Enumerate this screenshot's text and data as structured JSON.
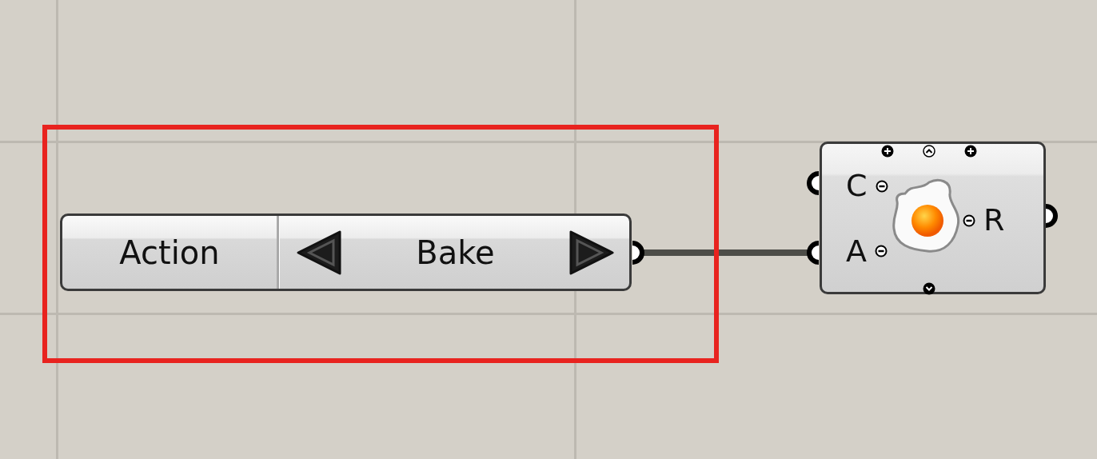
{
  "value_list": {
    "label": "Action",
    "value": "Bake"
  },
  "component": {
    "inputs": [
      {
        "name": "C"
      },
      {
        "name": "A"
      }
    ],
    "outputs": [
      {
        "name": "R"
      }
    ]
  },
  "highlight": {
    "color": "#e8231f"
  }
}
